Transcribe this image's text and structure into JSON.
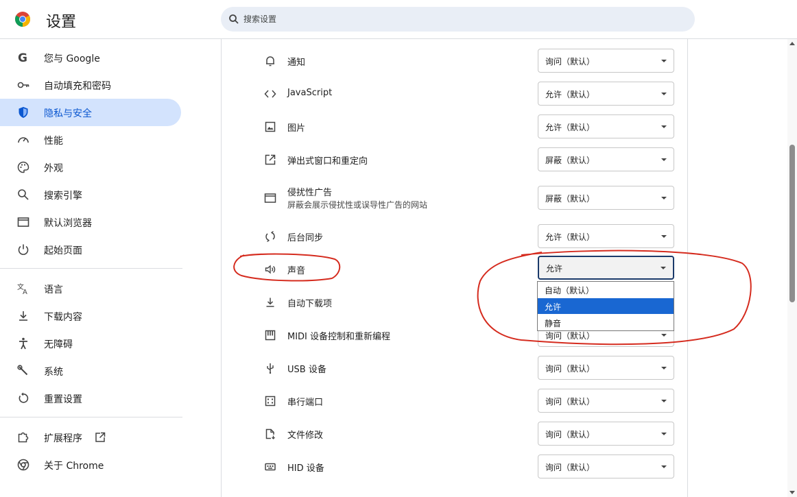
{
  "app": {
    "title": "设置",
    "brand_colors": {
      "accent": "#0b57d0",
      "active_bg": "#d3e3fd",
      "annotation": "#d52b1e"
    }
  },
  "search": {
    "placeholder": "搜索设置",
    "icon": "search-icon"
  },
  "sidebar": {
    "active_index": 2,
    "items": [
      {
        "label": "您与 Google",
        "icon": "google-g-icon"
      },
      {
        "label": "自动填充和密码",
        "icon": "key-icon"
      },
      {
        "label": "隐私与安全",
        "icon": "shield-icon"
      },
      {
        "label": "性能",
        "icon": "speedometer-icon"
      },
      {
        "label": "外观",
        "icon": "palette-icon"
      },
      {
        "label": "搜索引擎",
        "icon": "search-icon"
      },
      {
        "label": "默认浏览器",
        "icon": "browser-window-icon"
      },
      {
        "label": "起始页面",
        "icon": "power-icon"
      },
      {
        "label": "语言",
        "icon": "translate-icon"
      },
      {
        "label": "下载内容",
        "icon": "download-icon"
      },
      {
        "label": "无障碍",
        "icon": "accessibility-icon"
      },
      {
        "label": "系统",
        "icon": "wrench-icon"
      },
      {
        "label": "重置设置",
        "icon": "reset-icon"
      },
      {
        "label": "扩展程序",
        "icon": "puzzle-icon",
        "external_icon": "open-in-new-icon"
      },
      {
        "label": "关于 Chrome",
        "icon": "chrome-icon"
      }
    ]
  },
  "permissions": [
    {
      "label": "通知",
      "icon": "bell-icon",
      "value": "询问（默认）"
    },
    {
      "label": "JavaScript",
      "icon": "code-icon",
      "value": "允许（默认）"
    },
    {
      "label": "图片",
      "icon": "image-icon",
      "value": "允许（默认）"
    },
    {
      "label": "弹出式窗口和重定向",
      "icon": "open-external-icon",
      "value": "屏蔽（默认）"
    },
    {
      "label": "侵扰性广告",
      "sublabel": "屏蔽会展示侵扰性或误导性广告的网站",
      "icon": "ad-window-icon",
      "value": "屏蔽（默认）"
    },
    {
      "label": "后台同步",
      "icon": "sync-icon",
      "value": "允许（默认）"
    },
    {
      "label": "声音",
      "icon": "speaker-icon",
      "value": "允许",
      "focused": true
    },
    {
      "label": "自动下载项",
      "icon": "download-icon",
      "value": ""
    },
    {
      "label": "MIDI 设备控制和重新编程",
      "icon": "piano-icon",
      "value": "询问（默认）"
    },
    {
      "label": "USB 设备",
      "icon": "usb-icon",
      "value": "询问（默认）"
    },
    {
      "label": "串行端口",
      "icon": "serial-port-icon",
      "value": "询问（默认）"
    },
    {
      "label": "文件修改",
      "icon": "file-edit-icon",
      "value": "询问（默认）"
    },
    {
      "label": "HID 设备",
      "icon": "hid-device-icon",
      "value": "询问（默认）"
    }
  ],
  "sound_dropdown": {
    "selected_index": 1,
    "options": [
      "自动（默认）",
      "允许",
      "静音"
    ]
  }
}
